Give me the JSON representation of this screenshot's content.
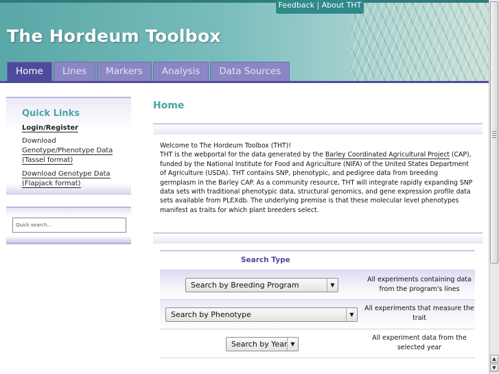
{
  "header": {
    "title": "The Hordeum Toolbox",
    "toplinks": {
      "feedback": "Feedback",
      "separator": "|",
      "about": "About THT"
    }
  },
  "nav": {
    "tabs": [
      {
        "label": "Home",
        "active": true
      },
      {
        "label": "Lines"
      },
      {
        "label": "Markers"
      },
      {
        "label": "Analysis"
      },
      {
        "label": "Data Sources"
      }
    ]
  },
  "sidebar": {
    "quick_links_title": "Quick Links",
    "login_label": "Login/Register",
    "download_tassel": {
      "line1": "Download",
      "line2": "Genotype/Phenotype Data",
      "line3": "(Tassel format)"
    },
    "download_flapjack": {
      "line1": "Download Genotype Data",
      "line2": "(Flapjack format)"
    },
    "search": {
      "placeholder": "Quick search..."
    }
  },
  "main": {
    "title": "Home",
    "intro": {
      "welcome": "Welcome to The Hordeum Toolbox (THT)!",
      "text_before_link": "THT is the webportal for the data generated by the ",
      "link": "Barley Coordinated Agricultural Project",
      "text_after_link": " (CAP), funded by the National Institute for Food and Agriculture (NIFA) of the United States Department of Agriculture (USDA). THT contains SNP, phenotypic, and pedigree data from breeding germplasm in the Barley CAP. As a community resource, THT will integrate rapidly expanding SNP data sets with traditional phenotypic data, structural genomics, and gene expression profile data sets available from PLEXdb. The underlying premise is that these molecular level phenotypes manifest as traits for which plant breeders select."
    },
    "search_type": {
      "header": "Search Type",
      "rows": [
        {
          "select": "Search by Breeding Program",
          "description": "All experiments containing data from the program's lines"
        },
        {
          "select": "Search by Phenotype",
          "description": "All experiments that measure the trait"
        },
        {
          "select": "Search by Year",
          "description": "All experiment data from the selected year"
        }
      ]
    }
  },
  "colors": {
    "header_teal": "#5aa7a7",
    "nav_purple": "#4e4a9c",
    "tab_inactive": "#8a87c4",
    "title_teal": "#4aa5a5"
  }
}
